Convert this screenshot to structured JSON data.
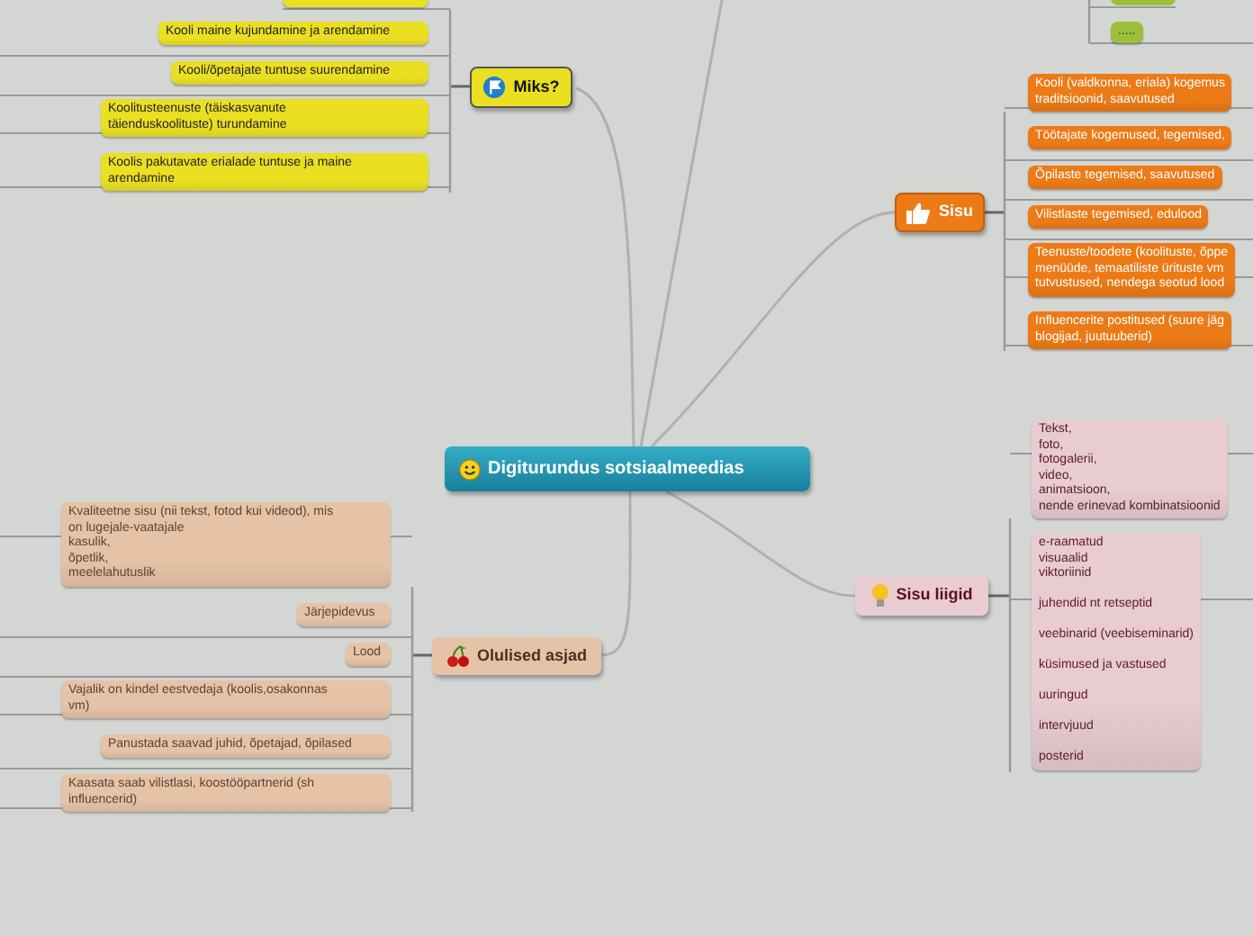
{
  "central": {
    "label": "Digiturundus sotsiaalmeedias"
  },
  "branches": [
    {
      "label": "Miks?",
      "color": "#ebdf22",
      "children": [
        {
          "label": "Kooli maine kujundamine ja arendamine"
        },
        {
          "label": "Kooli/õpetajate tuntuse suurendamine"
        },
        {
          "label": "Koolitusteenuste (täiskasvanute\ntäienduskoolituste) turundamine"
        },
        {
          "label": "Koolis pakutavate erialade tuntuse ja maine\narendamine"
        }
      ]
    },
    {
      "label": "Sisu",
      "color": "#ec7a16",
      "children": [
        {
          "label": "Kooli (valdkonna, eriala) kogemus\ntraditsioonid, saavutused"
        },
        {
          "label": "Töötajate kogemused, tegemised,"
        },
        {
          "label": "Õpilaste tegemised, saavutused"
        },
        {
          "label": "Vilistlaste tegemised, edulood"
        },
        {
          "label": "Teenuste/toodete (koolituste, õppe\nmenüüde, temaatiliste ürituste vm\ntutvustused, nendega seotud lood"
        },
        {
          "label": "Influencerite postitused (suure jäg\nblogijad, juutuuberid)"
        }
      ]
    },
    {
      "label": "Sisu liigid",
      "color": "#e8ccd2",
      "children": [
        {
          "label": "Tekst,\nfoto,\nfotogalerii,\nvideo,\nanimatsioon,\nnende erinevad kombinatsioonid"
        },
        {
          "label": "e-raamatud\nvisuaalid\nviktoriinid\n\njuhendid nt retseptid\n\nveebinarid (veebiseminarid)\n\nküsimused ja vastused\n\nuuringud\n\nintervjuud\n\nposterid"
        }
      ]
    },
    {
      "label": "Olulised asjad",
      "color": "#e6c3a7",
      "children": [
        {
          "label": "Kvaliteetne sisu (nii tekst, fotod kui videod), mis\non lugejale-vaatajale\nkasulik,\nõpetlik,\nmeelelahutuslik"
        },
        {
          "label": "Järjepidevus"
        },
        {
          "label": "Lood"
        },
        {
          "label": "Vajalik on kindel eestvedaja (koolis,osakonnas\nvm)"
        },
        {
          "label": "Panustada saavad juhid, õpetajad, õpilased"
        },
        {
          "label": "Kaasata saab vilistlasi, koostööpartnerid (sh\ninfluencerid)"
        }
      ]
    }
  ],
  "offscreen_branch": {
    "color": "#9cbf3a",
    "children": [
      {
        "label": "....."
      }
    ]
  }
}
